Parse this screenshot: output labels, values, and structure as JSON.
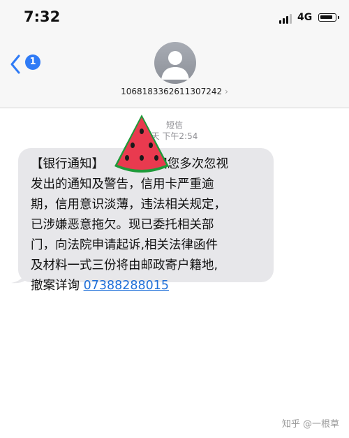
{
  "status_bar": {
    "time": "7:32",
    "network": "4G"
  },
  "header": {
    "back_badge": "1",
    "contact": "1068183362611307242",
    "contact_chevron": "›"
  },
  "thread": {
    "label": "短信",
    "timestamp": "天 下午2:54"
  },
  "message": {
    "text": "【银行通知】          ，因您多次忽视\n发出的通知及警告，信用卡严重逾\n期，信用意识淡薄，违法相关规定，\n已涉嫌恶意拖欠。现已委托相关部\n门，向法院申请起诉,相关法律函件\n及材料一式三份将由邮政寄户籍地,\n撤案详询 ",
    "phone_link": "07388288015"
  },
  "watermark": "知乎 @一根草",
  "colors": {
    "accent": "#2f7bf6",
    "bubble": "#e7e7ea",
    "link": "#1e6fd9"
  },
  "icons": {
    "back": "chevron-left-icon",
    "avatar": "person-silhouette-icon",
    "sticker": "watermelon-slice-icon"
  }
}
